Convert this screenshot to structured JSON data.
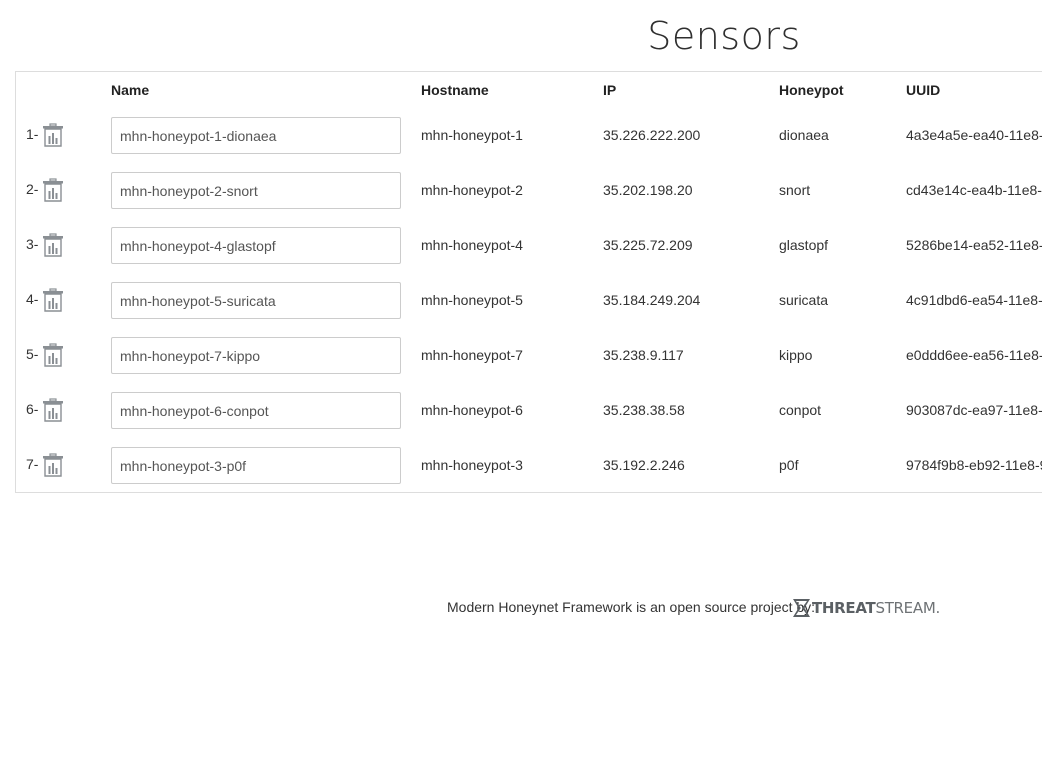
{
  "page": {
    "title": "Sensors"
  },
  "table": {
    "headers": {
      "name": "Name",
      "hostname": "Hostname",
      "ip": "IP",
      "honeypot": "Honeypot",
      "uuid": "UUID"
    },
    "rows": [
      {
        "index": "1-",
        "name": "mhn-honeypot-1-dionaea",
        "hostname": "mhn-honeypot-1",
        "ip": "35.226.222.200",
        "honeypot": "dionaea",
        "uuid": "4a3e4a5e-ea40-11e8-"
      },
      {
        "index": "2-",
        "name": "mhn-honeypot-2-snort",
        "hostname": "mhn-honeypot-2",
        "ip": "35.202.198.20",
        "honeypot": "snort",
        "uuid": "cd43e14c-ea4b-11e8-"
      },
      {
        "index": "3-",
        "name": "mhn-honeypot-4-glastopf",
        "hostname": "mhn-honeypot-4",
        "ip": "35.225.72.209",
        "honeypot": "glastopf",
        "uuid": "5286be14-ea52-11e8-"
      },
      {
        "index": "4-",
        "name": "mhn-honeypot-5-suricata",
        "hostname": "mhn-honeypot-5",
        "ip": "35.184.249.204",
        "honeypot": "suricata",
        "uuid": "4c91dbd6-ea54-11e8-"
      },
      {
        "index": "5-",
        "name": "mhn-honeypot-7-kippo",
        "hostname": "mhn-honeypot-7",
        "ip": "35.238.9.117",
        "honeypot": "kippo",
        "uuid": "e0ddd6ee-ea56-11e8-"
      },
      {
        "index": "6-",
        "name": "mhn-honeypot-6-conpot",
        "hostname": "mhn-honeypot-6",
        "ip": "35.238.38.58",
        "honeypot": "conpot",
        "uuid": "903087dc-ea97-11e8-"
      },
      {
        "index": "7-",
        "name": "mhn-honeypot-3-p0f",
        "hostname": "mhn-honeypot-3",
        "ip": "35.192.2.246",
        "honeypot": "p0f",
        "uuid": "9784f9b8-eb92-11e8-9"
      }
    ],
    "row_icon": "trash-icon"
  },
  "footer": {
    "text": "Modern Honeynet Framework is an open source project by:",
    "logo_bold": "THREAT",
    "logo_light": "STREAM.",
    "logo_icon": "threatstream-x-icon"
  },
  "colors": {
    "border": "#dddddd",
    "input_border": "#cccccc",
    "icon": "#8a8f94",
    "text": "#333333"
  }
}
